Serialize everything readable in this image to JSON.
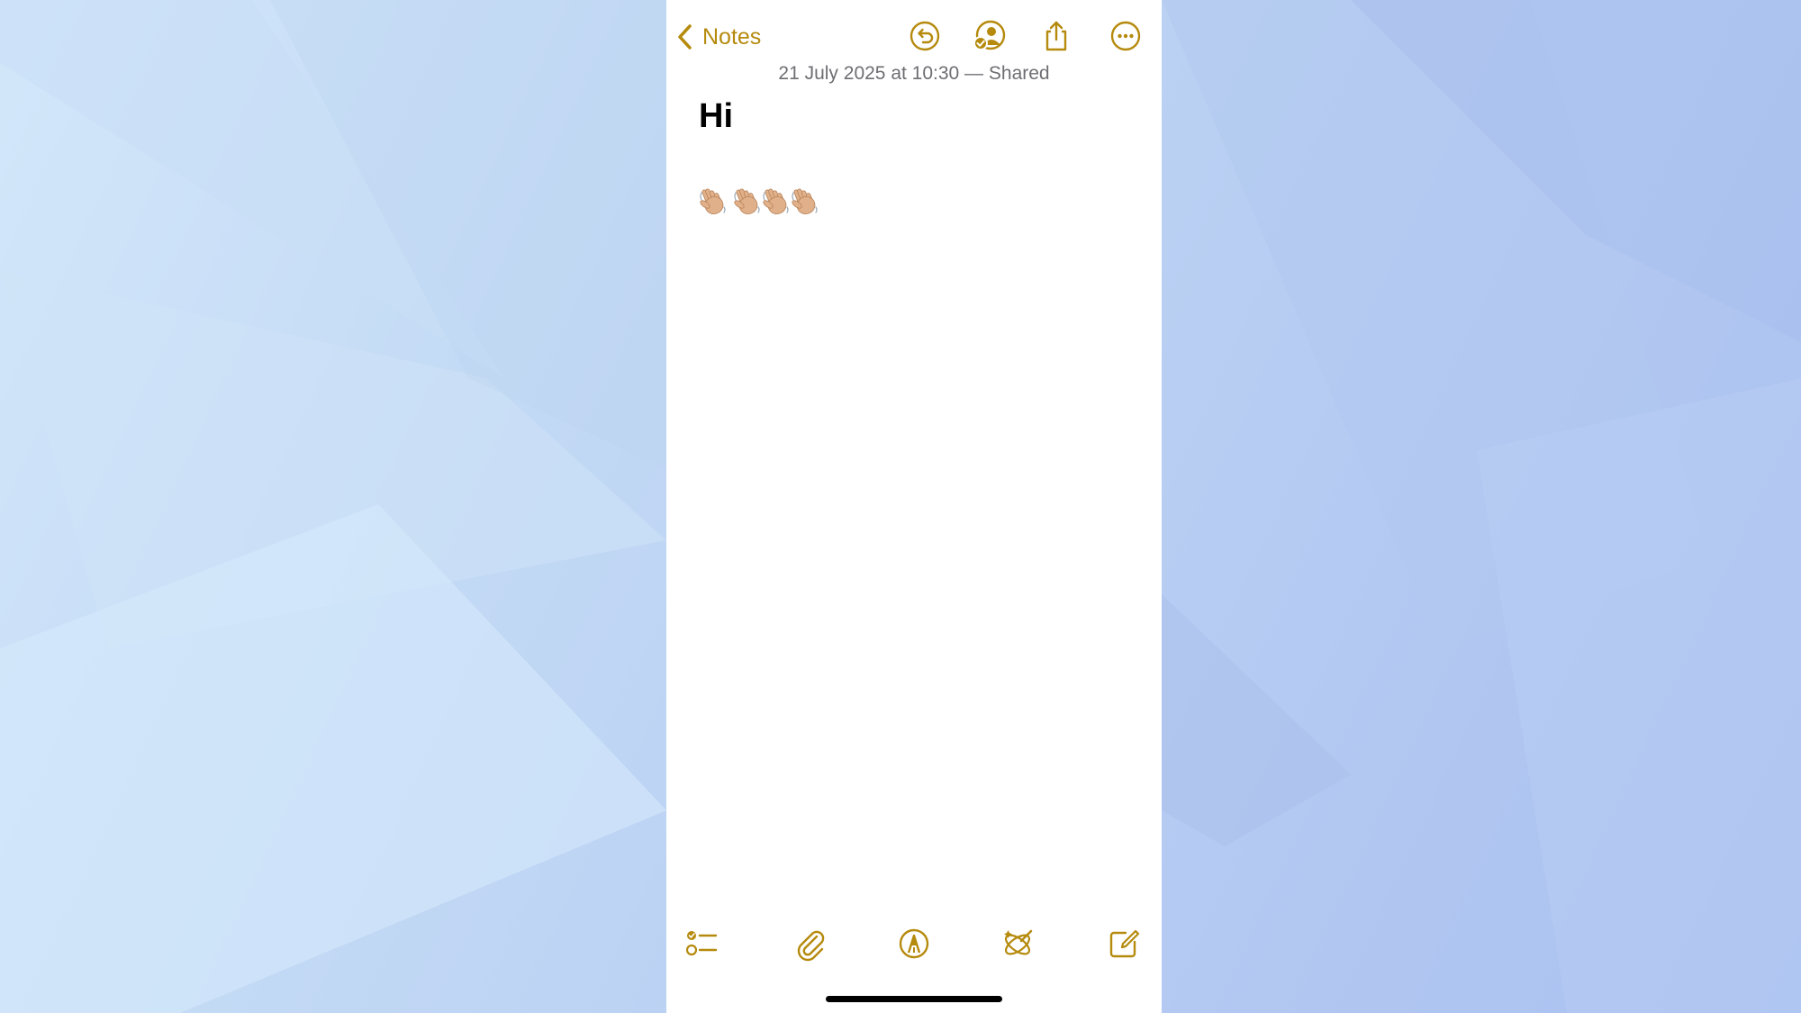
{
  "colors": {
    "accent": "#b58a0d",
    "meta_text": "#6e6e73",
    "note_background": "#ffffff",
    "wallpaper": "#bcd3f4"
  },
  "navbar": {
    "back_label": "Notes",
    "icons": [
      "chevron-left-icon",
      "undo-icon",
      "collaboration-icon",
      "share-icon",
      "more-options-icon"
    ]
  },
  "note": {
    "meta": "21 July 2025 at 10:30 — Shared",
    "title": "Hi",
    "body_emoji": [
      "👋🏼",
      "👋🏼",
      "👋🏼",
      "👋🏼"
    ]
  },
  "toolbar": {
    "icons": [
      "checklist-icon",
      "attachment-icon",
      "markup-icon",
      "writing-tools-icon",
      "compose-icon"
    ]
  }
}
